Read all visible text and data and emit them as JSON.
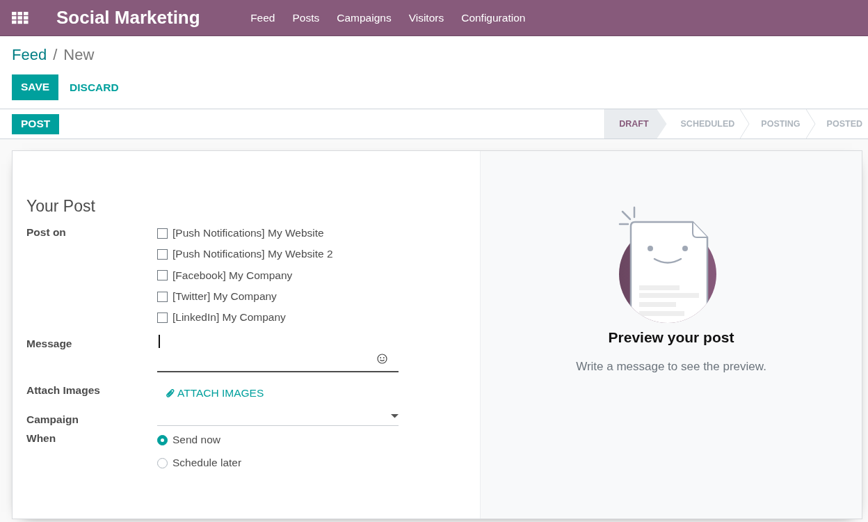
{
  "navbar": {
    "app_name": "Social Marketing",
    "menu": [
      {
        "label": "Feed"
      },
      {
        "label": "Posts"
      },
      {
        "label": "Campaigns"
      },
      {
        "label": "Visitors"
      },
      {
        "label": "Configuration"
      }
    ]
  },
  "breadcrumb": {
    "parent": "Feed",
    "separator": "/",
    "current": "New"
  },
  "actions": {
    "save": "SAVE",
    "discard": "DISCARD",
    "post": "POST"
  },
  "stages": [
    {
      "label": "DRAFT",
      "selected": true
    },
    {
      "label": "SCHEDULED",
      "selected": false
    },
    {
      "label": "POSTING",
      "selected": false
    },
    {
      "label": "POSTED",
      "selected": false
    }
  ],
  "form": {
    "title": "Your Post",
    "post_on": {
      "label": "Post on",
      "accounts": [
        {
          "label": "[Push Notifications] My Website",
          "checked": false
        },
        {
          "label": "[Push Notifications] My Website 2",
          "checked": false
        },
        {
          "label": "[Facebook] My Company",
          "checked": false
        },
        {
          "label": "[Twitter] My Company",
          "checked": false
        },
        {
          "label": "[LinkedIn] My Company",
          "checked": false
        }
      ]
    },
    "message": {
      "label": "Message",
      "focused": true
    },
    "attach": {
      "label": "Attach Images",
      "button": "ATTACH IMAGES"
    },
    "campaign": {
      "label": "Campaign"
    },
    "when": {
      "label": "When",
      "options": [
        {
          "label": "Send now",
          "selected": true
        },
        {
          "label": "Schedule later",
          "selected": false
        }
      ]
    }
  },
  "preview": {
    "title": "Preview your post",
    "hint": "Write a message to see the preview."
  }
}
